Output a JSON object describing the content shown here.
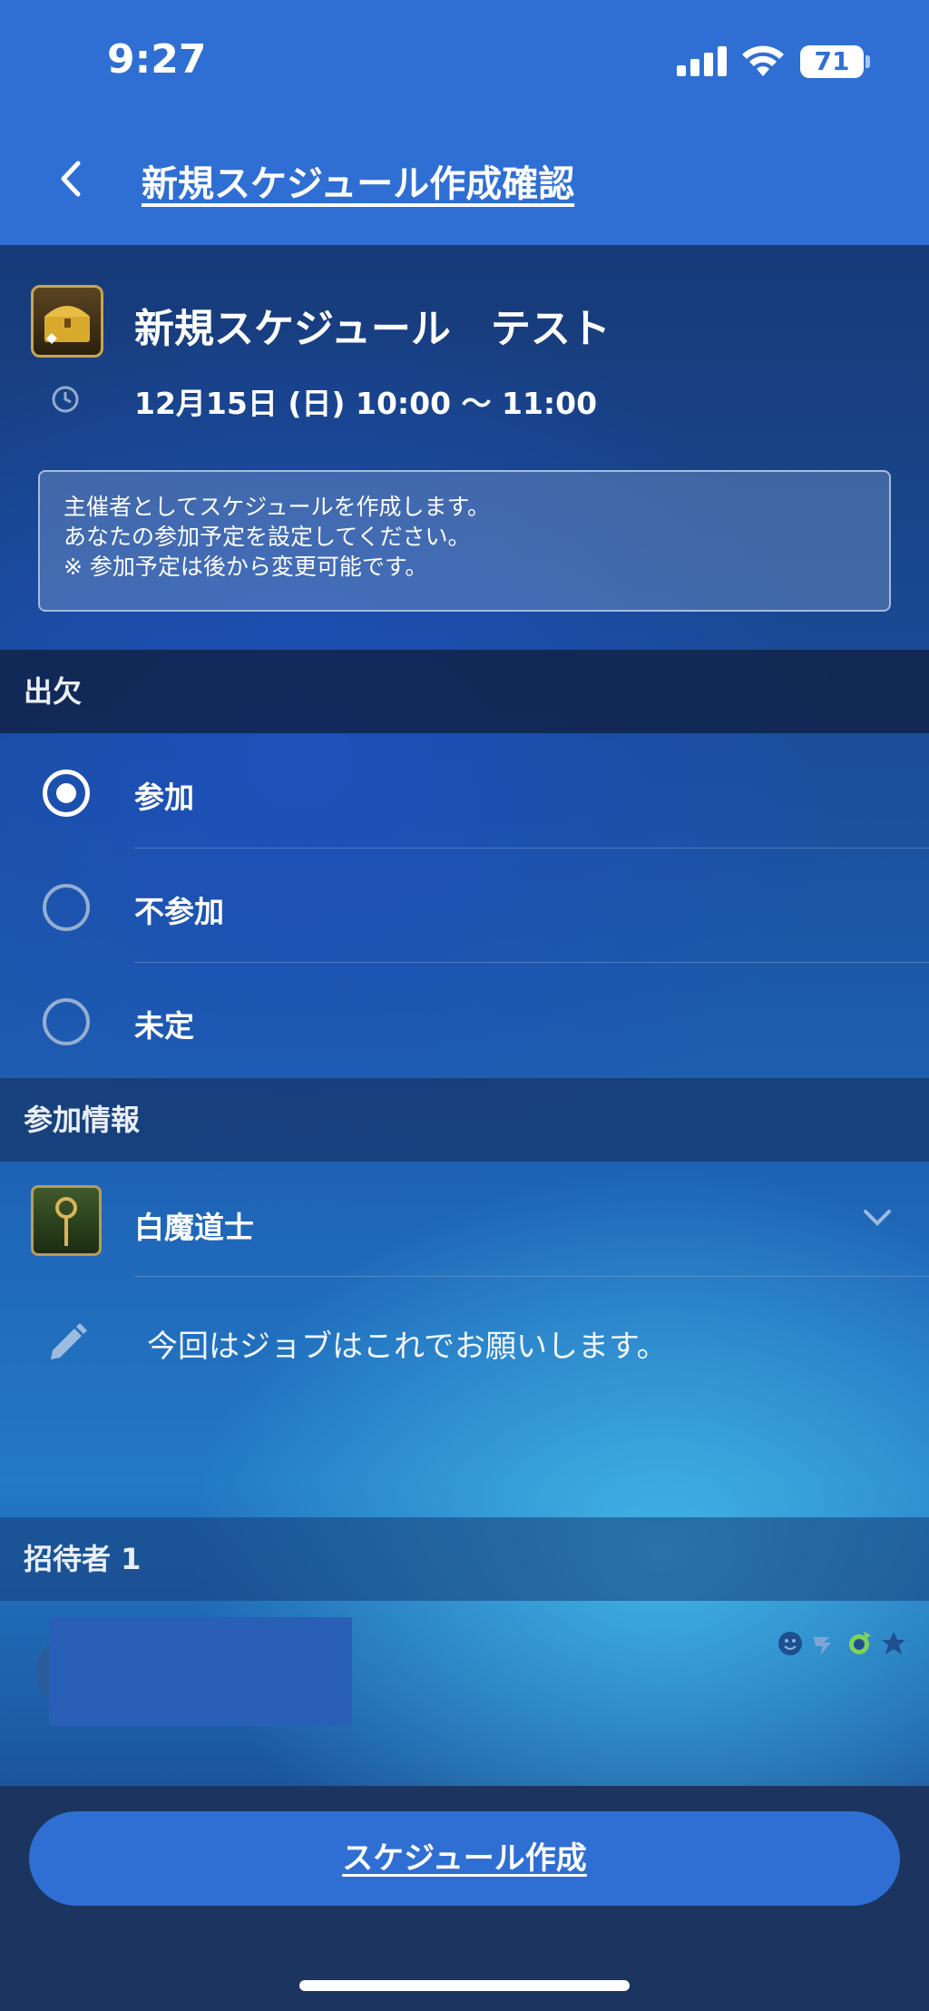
{
  "status_bar": {
    "time": "9:27",
    "battery": "71"
  },
  "header": {
    "title": "新規スケジュール作成確認"
  },
  "event": {
    "title": "新規スケジュール　テスト",
    "date": "12月15日 (日) 10:00 〜 11:00",
    "icon": "treasure-chest-icon"
  },
  "notice": {
    "lines": [
      "主催者としてスケジュールを作成します。",
      "あなたの参加予定を設定してください。",
      "※ 参加予定は後から変更可能です。"
    ]
  },
  "attendance": {
    "header": "出欠",
    "options": [
      {
        "label": "参加",
        "selected": true
      },
      {
        "label": "不参加",
        "selected": false
      },
      {
        "label": "未定",
        "selected": false
      }
    ]
  },
  "participation": {
    "header": "参加情報",
    "job": "白魔道士",
    "comment": "今回はジョブはこれでお願いします。"
  },
  "invitees": {
    "header": "招待者 1"
  },
  "footer": {
    "create_button": "スケジュール作成"
  },
  "colors": {
    "accent_blue": "#2f6fd4",
    "dark_footer": "#1b3560"
  }
}
